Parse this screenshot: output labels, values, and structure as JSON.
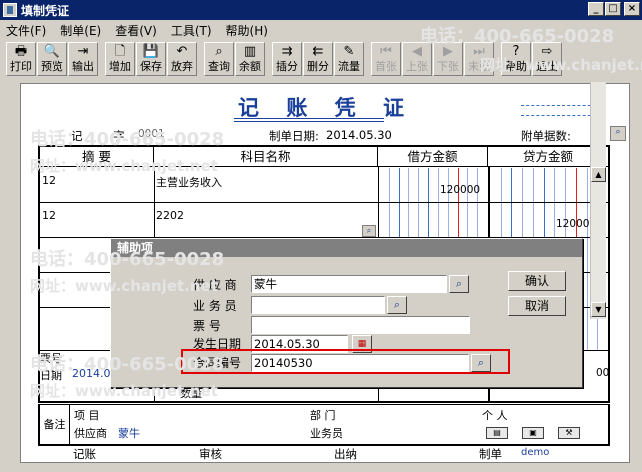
{
  "window": {
    "title": "填制凭证",
    "min": "_",
    "max": "□",
    "close": "×"
  },
  "menu": [
    "文件(F)",
    "制单(E)",
    "查看(V)",
    "工具(T)",
    "帮助(H)"
  ],
  "toolbar": [
    {
      "id": "print",
      "label": "打印",
      "icon": "printer-icon",
      "glyph": "🖶",
      "enabled": true
    },
    {
      "id": "preview",
      "label": "预览",
      "icon": "preview-icon",
      "glyph": "🔍",
      "enabled": true
    },
    {
      "id": "export",
      "label": "输出",
      "icon": "export-icon",
      "glyph": "⇥",
      "enabled": true
    },
    {
      "id": "add",
      "label": "增加",
      "icon": "new-document-icon",
      "glyph": "🗋",
      "enabled": true
    },
    {
      "id": "save",
      "label": "保存",
      "icon": "save-icon",
      "glyph": "💾",
      "enabled": true
    },
    {
      "id": "discard",
      "label": "放弃",
      "icon": "undo-icon",
      "glyph": "↶",
      "enabled": true
    },
    {
      "id": "query",
      "label": "查询",
      "icon": "binoculars-icon",
      "glyph": "⌕",
      "enabled": true
    },
    {
      "id": "balance",
      "label": "余额",
      "icon": "bar-chart-icon",
      "glyph": "▥",
      "enabled": true
    },
    {
      "id": "insert-line",
      "label": "插分",
      "icon": "insert-line-icon",
      "glyph": "⇉",
      "enabled": true
    },
    {
      "id": "delete-line",
      "label": "删分",
      "icon": "delete-line-icon",
      "glyph": "⇇",
      "enabled": true
    },
    {
      "id": "cashflow",
      "label": "流量",
      "icon": "cashflow-icon",
      "glyph": "✎",
      "enabled": true
    },
    {
      "id": "first",
      "label": "首张",
      "icon": "first-page-icon",
      "glyph": "⏮",
      "enabled": false
    },
    {
      "id": "prev",
      "label": "上张",
      "icon": "prev-page-icon",
      "glyph": "◀",
      "enabled": false
    },
    {
      "id": "next",
      "label": "下张",
      "icon": "next-page-icon",
      "glyph": "▶",
      "enabled": false
    },
    {
      "id": "last",
      "label": "末张",
      "icon": "last-page-icon",
      "glyph": "⏭",
      "enabled": false
    },
    {
      "id": "help",
      "label": "帮助",
      "icon": "help-icon",
      "glyph": "?",
      "enabled": true
    },
    {
      "id": "exit",
      "label": "退出",
      "icon": "exit-icon",
      "glyph": "⇨",
      "enabled": true
    }
  ],
  "voucher": {
    "title": "记 账 凭 证",
    "type_label": "记",
    "number_label": "字",
    "number": "0001",
    "date_label": "制单日期:",
    "date": "2014.05.30",
    "attach_label": "附单据数:",
    "columns": {
      "summary": "摘 要",
      "account": "科目名称",
      "debit": "借方金额",
      "credit": "贷方金额"
    },
    "rows": [
      {
        "summary": "12",
        "account": "主营业务收入",
        "debit": "120000",
        "credit": ""
      },
      {
        "summary": "12",
        "account": "2202",
        "debit": "",
        "credit": "120000"
      }
    ],
    "left_labels": {
      "ticket_no": "票号",
      "date": "日期",
      "date_value": "2014.05",
      "qty": "数量",
      "price_tail": "00"
    },
    "note_label": "备注",
    "footer": {
      "project_label": "项  目",
      "dept_label": "部  门",
      "person_label": "个  人",
      "supplier_label": "供应商",
      "supplier_value": "蒙牛",
      "salesman_label": "业务员"
    },
    "bottom": {
      "bookkeep": "记账",
      "audit": "审核",
      "cashier": "出纳",
      "maker": "制单",
      "maker_value": "demo"
    }
  },
  "dialog": {
    "title": "辅助项",
    "fields": [
      {
        "label": "供 应 商",
        "value": "蒙牛"
      },
      {
        "label": "业 务 员",
        "value": ""
      },
      {
        "label": "票    号",
        "value": ""
      },
      {
        "label": "发生日期",
        "value": "2014.05.30"
      },
      {
        "label": "合同编号",
        "value": "20140530"
      }
    ],
    "ok": "确认",
    "cancel": "取消"
  },
  "watermarks": [
    "电话：400-665-0028",
    "网址：www.chanjet.net"
  ]
}
